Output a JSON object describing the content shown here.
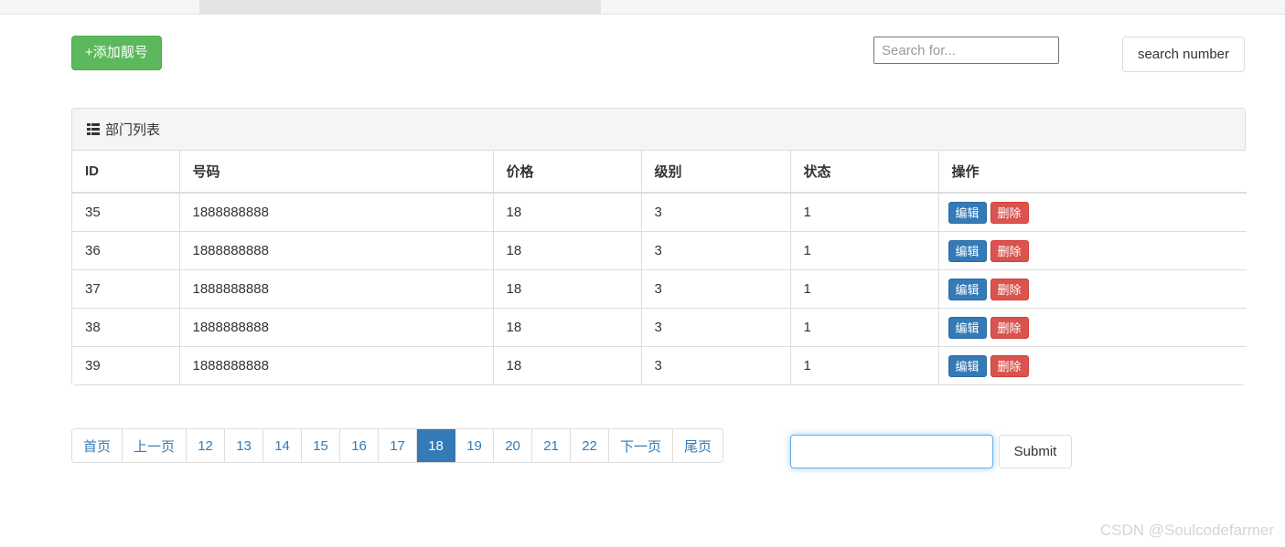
{
  "toolbar": {
    "add_label": "+添加靓号",
    "search_placeholder": "Search for...",
    "search_value": "",
    "search_button_label": "search number"
  },
  "panel": {
    "title": "部门列表",
    "icon": "list-icon"
  },
  "table": {
    "columns": [
      "ID",
      "号码",
      "价格",
      "级别",
      "状态",
      "操作"
    ],
    "rows": [
      {
        "id": "35",
        "number": "1888888888",
        "price": "18",
        "level": "3",
        "status": "1",
        "edit_label": "编辑",
        "delete_label": "删除"
      },
      {
        "id": "36",
        "number": "1888888888",
        "price": "18",
        "level": "3",
        "status": "1",
        "edit_label": "编辑",
        "delete_label": "删除"
      },
      {
        "id": "37",
        "number": "1888888888",
        "price": "18",
        "level": "3",
        "status": "1",
        "edit_label": "编辑",
        "delete_label": "删除"
      },
      {
        "id": "38",
        "number": "1888888888",
        "price": "18",
        "level": "3",
        "status": "1",
        "edit_label": "编辑",
        "delete_label": "删除"
      },
      {
        "id": "39",
        "number": "1888888888",
        "price": "18",
        "level": "3",
        "status": "1",
        "edit_label": "编辑",
        "delete_label": "删除"
      }
    ]
  },
  "pagination": {
    "items": [
      {
        "label": "首页",
        "active": false
      },
      {
        "label": "上一页",
        "active": false
      },
      {
        "label": "12",
        "active": false
      },
      {
        "label": "13",
        "active": false
      },
      {
        "label": "14",
        "active": false
      },
      {
        "label": "15",
        "active": false
      },
      {
        "label": "16",
        "active": false
      },
      {
        "label": "17",
        "active": false
      },
      {
        "label": "18",
        "active": true
      },
      {
        "label": "19",
        "active": false
      },
      {
        "label": "20",
        "active": false
      },
      {
        "label": "21",
        "active": false
      },
      {
        "label": "22",
        "active": false
      },
      {
        "label": "下一页",
        "active": false
      },
      {
        "label": "尾页",
        "active": false
      }
    ],
    "current_page": "18",
    "jump_value": "",
    "jump_placeholder": "",
    "submit_label": "Submit"
  },
  "watermark": "CSDN @Soulcodefarmer",
  "colors": {
    "add_button": "#5cb85c",
    "edit_button": "#337ab7",
    "delete_button": "#d9534f",
    "active_page": "#337ab7",
    "focus_border": "#66afe9",
    "panel_border": "#dddddd"
  }
}
